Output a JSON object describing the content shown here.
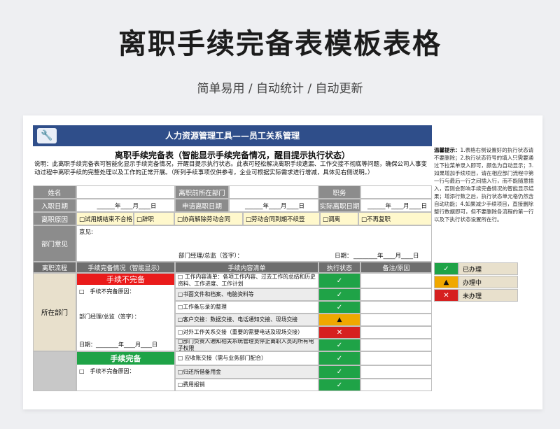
{
  "page": {
    "title": "离职手续完备表模板表格",
    "subtitle": "简单易用 / 自动统计 / 自动更新"
  },
  "sheet": {
    "banner": "人力资源管理工具——员工关系管理",
    "heading": "离职手续完备表（智能显示手续完备情况，醒目提示执行状态）",
    "note": "说明：此离职手续完备表可智能化显示手续完备情况，开醒目提示执行状态。此表可轻松解决离职手续遗漏、工作交接不彻底等问题，确保公司人事变动过程中离职手续的完整处理以及工作的正常开展。（所列手续事项仅供参考，企业可根据实际需求进行增减，具体见右侧说明。）",
    "fields": {
      "name": "姓名",
      "dept": "离职前所在部门",
      "position": "职务",
      "join_date": "入职日期",
      "apply_date": "申请离职日期",
      "actual_date": "实际离职日期",
      "date_fill": "______年____月____日",
      "reason": "离职原因",
      "dept_opinion": "部门意见",
      "opinion_label": "意见:",
      "manager_sign": "部门经理/总监（签字）：",
      "date_label": "日期：",
      "date_fill2": "________年____月____日"
    },
    "reasons": [
      "□试用期结束不合格",
      "□辞职",
      "□协商解除劳动合同",
      "□劳动合同到期不续签",
      "□调离",
      "□不再复职"
    ],
    "headers": [
      "离职流程",
      "手续完备情况（智能显示）",
      "手续内容清单",
      "执行状态",
      "备注/原因"
    ],
    "section1": {
      "name": "所在部门",
      "status_bar": "手续不完备",
      "reason_line": "□　手续不完备原因：",
      "sign_line": "部门经理/总监（签字）：",
      "date_line": "日期：________年____月____日",
      "items": [
        {
          "text": "□ 工作内容清单：各项工作内容、过去工作的总结和历史资料、工作进度、工作计划",
          "status": "✓",
          "kind": "ok"
        },
        {
          "text": "□书面文件和档案、电脑资料等",
          "status": "✓",
          "kind": "ok"
        },
        {
          "text": "□工作备忘录的整理",
          "status": "✓",
          "kind": "ok"
        },
        {
          "text": "□客户交接：数据交接、电话通知交接、现场交接",
          "status": "▲",
          "kind": "prog"
        },
        {
          "text": "□对外工作关系交接（重要的需要电话及现场交接）",
          "status": "✕",
          "kind": "no"
        },
        {
          "text": "□部门负责人通知相关系统管理员停止离职人员的所有电子权限",
          "status": "✓",
          "kind": "ok"
        }
      ]
    },
    "section2": {
      "status_bar": "手续完备",
      "reason_line": "□　手续不完备原因：",
      "items": [
        {
          "text": "□ 应收账交接（需与业务部门配合）",
          "status": "✓",
          "kind": "ok"
        },
        {
          "text": "□归还所借备用金",
          "status": "✓",
          "kind": "ok"
        },
        {
          "text": "□费用报销",
          "status": "✓",
          "kind": "ok"
        }
      ]
    },
    "legend": [
      {
        "symbol": "✓",
        "label": "已办理",
        "kind": "ok"
      },
      {
        "symbol": "▲",
        "label": "办理中",
        "kind": "prog"
      },
      {
        "symbol": "✕",
        "label": "未办理",
        "kind": "no"
      }
    ],
    "tips": {
      "title": "温馨提示：",
      "body": "1.表格右侧设置好的执行状态请不要删除；2.执行状态符号的填入只需要通过下拉菜单录入即可，颜色为自动显示；3.如果增加手续项目，请在相应部门流程中第一行与最后一行之间插入行，而不能随意插入，否则会影响手续完备情况的智能显示结果；增添行数之后，执行状态单元格仍然含自动功能；4.如果减少手续项目，直接删除整行数据即可，但不要删除各流程的第一行以及下执行状态设置所在行。"
    }
  }
}
